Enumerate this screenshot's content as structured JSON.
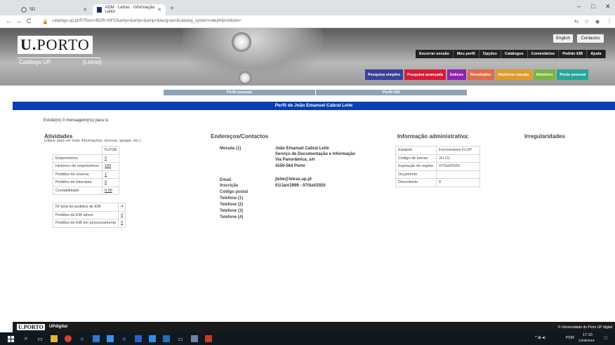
{
  "browser": {
    "tabs": [
      {
        "title": "SD"
      },
      {
        "title": "ADM · Letras · Informação Leitor"
      }
    ],
    "url": "catalogo.up.pt/F/?func=BOR-INFO&amp=&amp=&amp=&lang=por&catalog_system=aleph&institute=",
    "window_controls": [
      "–",
      "□",
      "✕"
    ],
    "nav": [
      "←",
      "→",
      "C",
      "⌂"
    ]
  },
  "header": {
    "logo_u": "U.",
    "logo_rest": "PORTO",
    "catalog_label": "Catálogo UP",
    "faculty_label": "[Letras]",
    "lang_button": "English",
    "contacts_button": "Contactos",
    "menu": [
      "Encerrar sessão",
      "Meu perfil",
      "Opções",
      "Catálogos",
      "Comentários",
      "Pedido EIB",
      "Ajuda"
    ],
    "search_tabs": [
      {
        "label": "Pesquisa simples",
        "color": "#3b3f9e"
      },
      {
        "label": "Pesquisa avançada",
        "color": "#d81b3a"
      },
      {
        "label": "Índices",
        "color": "#8e24aa"
      },
      {
        "label": "Resultados",
        "color": "#e06c4a"
      },
      {
        "label": "Histórico sessão",
        "color": "#e09c2a"
      },
      {
        "label": "Histórico",
        "color": "#7cb342"
      },
      {
        "label": "Pesto pessoal",
        "color": "#26a69a"
      }
    ]
  },
  "subnav": [
    "Perfil pessoal",
    "Perfil USI"
  ],
  "page_title": "Perfil de João Emanuel Cabral Leite",
  "message": "Existe(m) 0 mensagem(ns) para si.",
  "activities": {
    "heading": "Atividades",
    "note": "(clique para ver mais informações, renovar, apagar, etc.)",
    "col_header": "FLPSB",
    "rows": [
      {
        "label": "Empréstimos",
        "value": "0"
      },
      {
        "label": "Histórico de empréstimos",
        "value": "159"
      },
      {
        "label": "Pedidos de reserva",
        "value": "1"
      },
      {
        "label": "Pedidos de fotocópia",
        "value": "0"
      },
      {
        "label": "Contabilidade",
        "value": "0.00"
      }
    ],
    "eib_rows": [
      {
        "label": "Nº total de pedidos de EIB",
        "value": "4"
      },
      {
        "label": "Pedidos de EIB ativos",
        "value": "0"
      },
      {
        "label": "Pedidos de EIB em processamento",
        "value": "0"
      }
    ]
  },
  "contacts": {
    "heading": "Endereços/Contactos",
    "address_label": "Morada (1)",
    "address_lines": [
      "João Emanuel Cabral Leite",
      "Serviço de Documentação e Informação",
      "Via Panorâmica, s/n",
      "4150-564 Porto"
    ],
    "email_label": "Email",
    "email_value": "jleite@letras.up.pt",
    "inscricao_label": "Inscrição",
    "inscricao_value": "01/Jan/1999 - 07/Set/2020",
    "other_labels": [
      "Código postal",
      "Telefone (1)",
      "Telefone (2)",
      "Telefone (3)",
      "Telefone (4)"
    ]
  },
  "admin": {
    "heading": "Informação administrativa:",
    "rows": [
      {
        "label": "Estatuto",
        "value": "Funcionários FLUP"
      },
      {
        "label": "Código de barras",
        "value": "JLL/1L"
      },
      {
        "label": "Expiração do registo",
        "value": "07/Set/2020"
      },
      {
        "label": "Orçamento",
        "value": ""
      },
      {
        "label": "Descoberto",
        "value": "0"
      }
    ]
  },
  "irregularities": {
    "heading": "Irregularidades"
  },
  "footer": {
    "logo": "U.PORTO",
    "up_label": "UPdigital",
    "copyright": "© Universidade do Porto  UP digital"
  },
  "taskbar": {
    "lang": "POR",
    "time": "17:10",
    "date": "12/09/2019"
  }
}
